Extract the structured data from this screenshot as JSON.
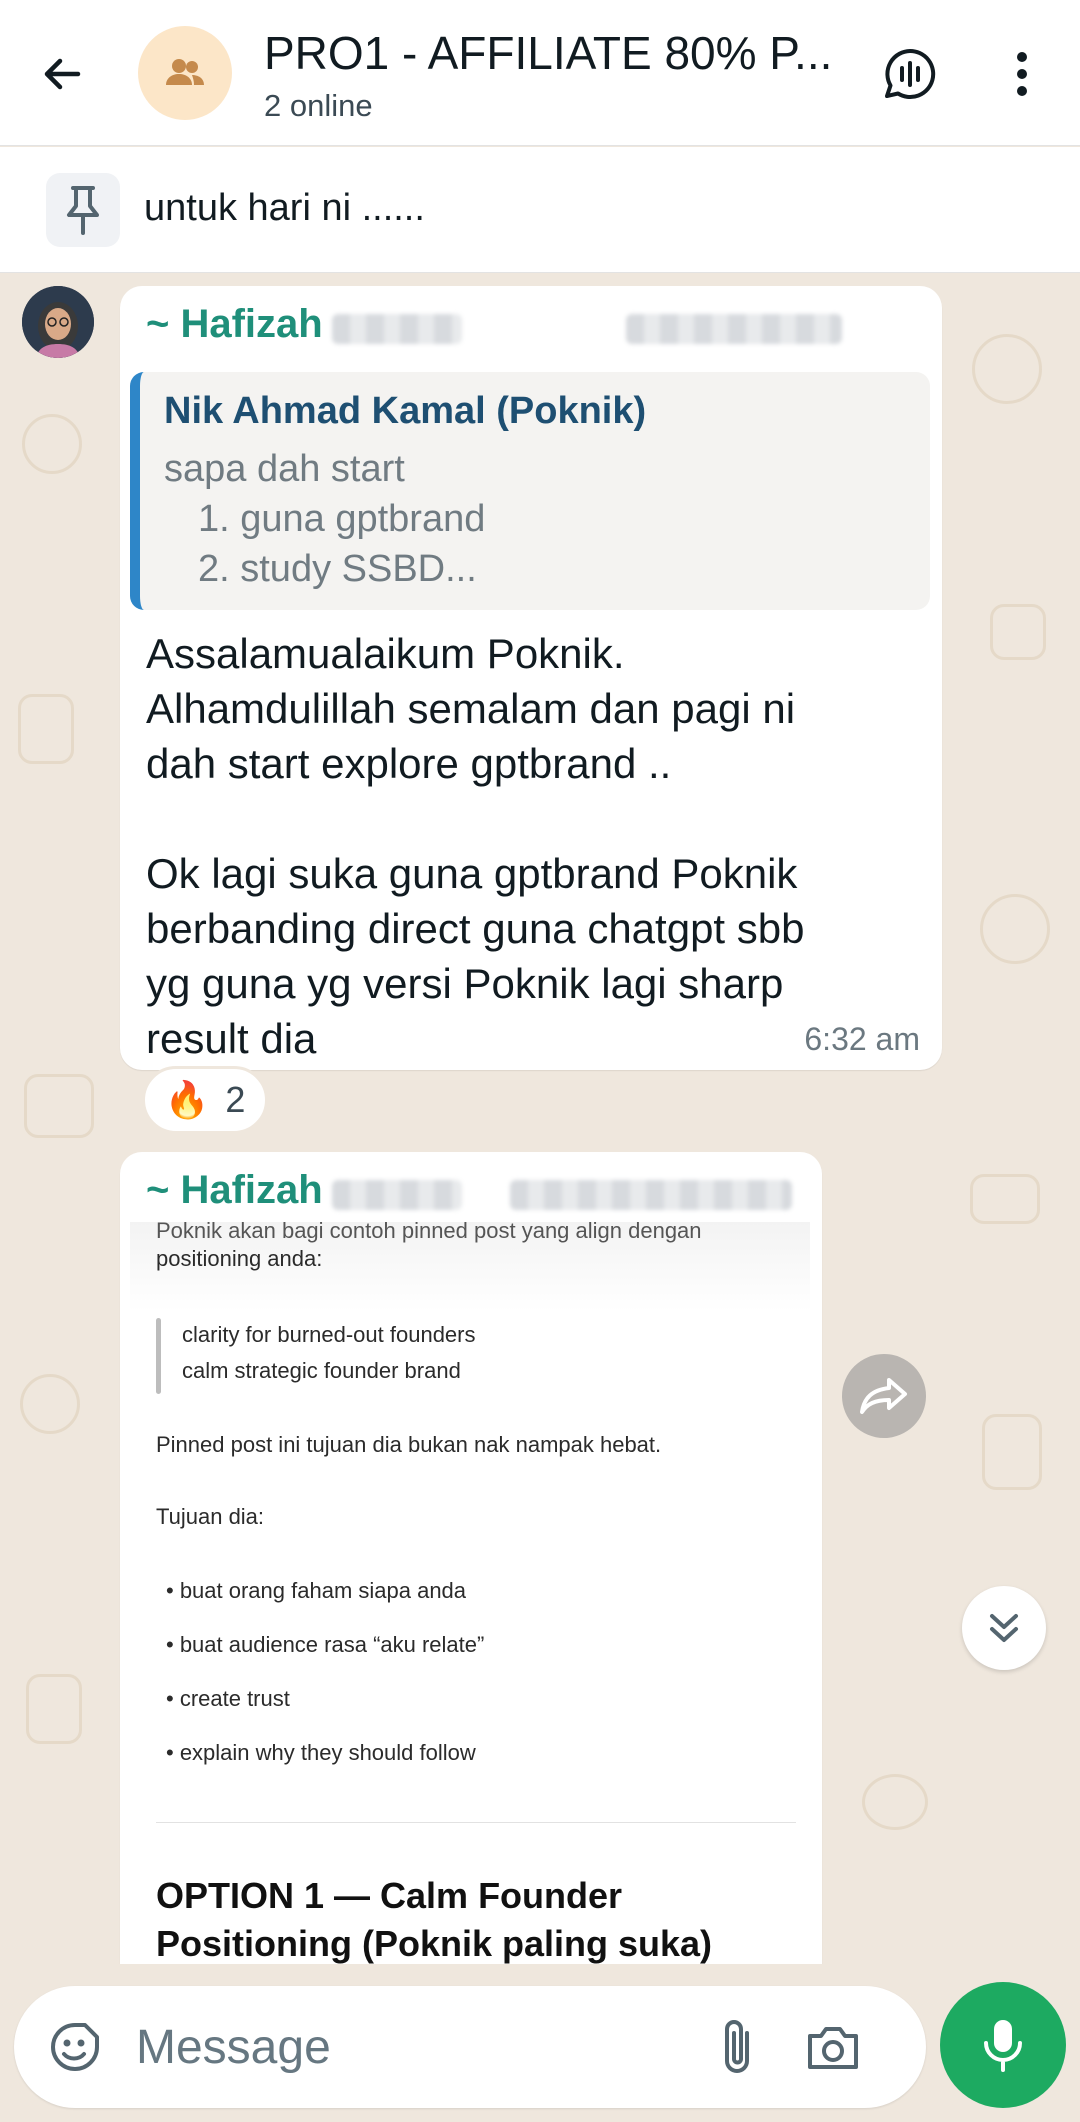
{
  "header": {
    "title": "PRO1 - AFFILIATE 80% P...",
    "subtitle": "2 online"
  },
  "pinned": {
    "text": "untuk hari ni ......"
  },
  "messages": [
    {
      "sender": "~ Hafizah",
      "quote": {
        "author": "Nik Ahmad Kamal (Poknik)",
        "lines": [
          "sapa dah start",
          "1. guna gptbrand",
          "2. study SSBD..."
        ]
      },
      "paragraphs": [
        "Assalamualaikum Poknik.\nAlhamdulillah semalam dan pagi ni\ndah start explore gptbrand ..",
        "Ok lagi suka guna gptbrand Poknik\nberbanding direct guna chatgpt sbb\nyg guna yg versi Poknik lagi sharp\nresult dia"
      ],
      "time": "6:32 am",
      "reaction": {
        "emoji": "🔥",
        "count": "2"
      }
    },
    {
      "sender": "~ Hafizah",
      "doc": {
        "intro_1": "Poknik akan bagi contoh pinned post yang align dengan",
        "intro_2": "positioning anda:",
        "quote_1": "clarity for burned-out founders",
        "quote_2": "calm strategic founder brand",
        "line_1": "Pinned post ini tujuan dia bukan nak nampak hebat.",
        "line_2": "Tujuan dia:",
        "bullets": [
          "• buat orang faham siapa anda",
          "• buat audience rasa “aku relate”",
          "• create trust",
          "• explain why they should follow"
        ],
        "heading_1": "OPTION 1 — Calm Founder",
        "heading_2": "Positioning (Poknik paling suka)"
      }
    }
  ],
  "composer": {
    "placeholder": "Message"
  },
  "colors": {
    "accent_green": "#1daa61",
    "sender_name": "#1f8f7a",
    "quote_bar": "#2e86c8",
    "wallpaper": "#efe7dd"
  },
  "icons": [
    "back-arrow-icon",
    "group-icon",
    "voice-chat-icon",
    "more-vert-icon",
    "pin-icon",
    "forward-icon",
    "scroll-down-icon",
    "sticker-icon",
    "attach-icon",
    "camera-icon",
    "mic-icon"
  ]
}
